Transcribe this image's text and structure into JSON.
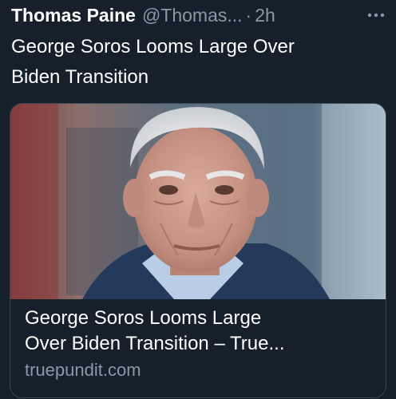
{
  "tweet": {
    "display_name": "Thomas Paine",
    "handle": "@Thomas...",
    "separator": "·",
    "time": "2h",
    "more_icon": "more-horizontal-icon",
    "text": "George Soros Looms Large Over\nBiden Transition"
  },
  "card": {
    "title": "George Soros Looms Large\nOver Biden Transition – True...",
    "domain": "truepundit.com"
  },
  "colors": {
    "background": "#15202b",
    "secondary_text": "#8b98a5",
    "border": "#38444d"
  }
}
